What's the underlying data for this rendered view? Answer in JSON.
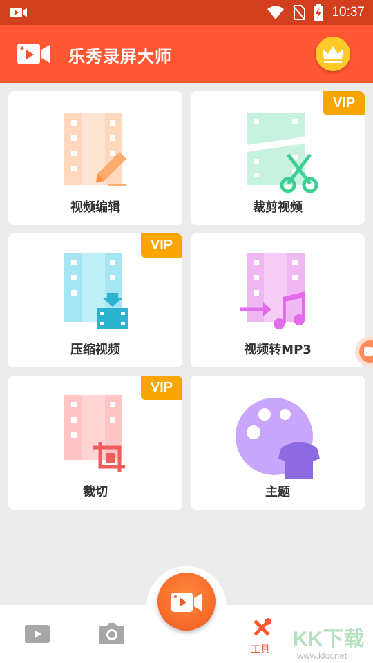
{
  "status_bar": {
    "time": "10:37",
    "icons": [
      "video-notification-icon",
      "wifi-icon",
      "no-sim-icon",
      "battery-charging-icon"
    ]
  },
  "app_bar": {
    "title": "乐秀录屏大师",
    "logo_icon": "camera-logo-icon",
    "action_icon": "crown-icon"
  },
  "tools": [
    {
      "label": "视频编辑",
      "vip": "",
      "icon": "film-pencil-icon",
      "color": "#ffd8bd"
    },
    {
      "label": "裁剪视频",
      "vip": "VIP",
      "icon": "film-scissors-icon",
      "color": "#c8f2e0"
    },
    {
      "label": "压缩视频",
      "vip": "VIP",
      "icon": "film-compress-icon",
      "color": "#a6e6f2"
    },
    {
      "label": "视频转MP3",
      "vip": "",
      "icon": "film-music-icon",
      "color": "#f0b8f2"
    },
    {
      "label": "裁切",
      "vip": "VIP",
      "icon": "film-crop-icon",
      "color": "#ffc4c4"
    },
    {
      "label": "主题",
      "vip": "",
      "icon": "palette-shirt-icon",
      "color": "#c7a6fb"
    }
  ],
  "bottom_nav": {
    "items": [
      {
        "icon": "video-library-icon",
        "label": ""
      },
      {
        "icon": "camera-icon",
        "label": ""
      },
      {
        "icon": "record-button-icon",
        "label": ""
      },
      {
        "icon": "tools-icon",
        "label": "工具"
      }
    ],
    "active_color": "#ff5733"
  },
  "watermark": {
    "text": "KK下载",
    "url": "www.kkx.net"
  },
  "colors": {
    "accent": "#ff5733",
    "status": "#d23f1f",
    "vip": "#f9a504"
  }
}
